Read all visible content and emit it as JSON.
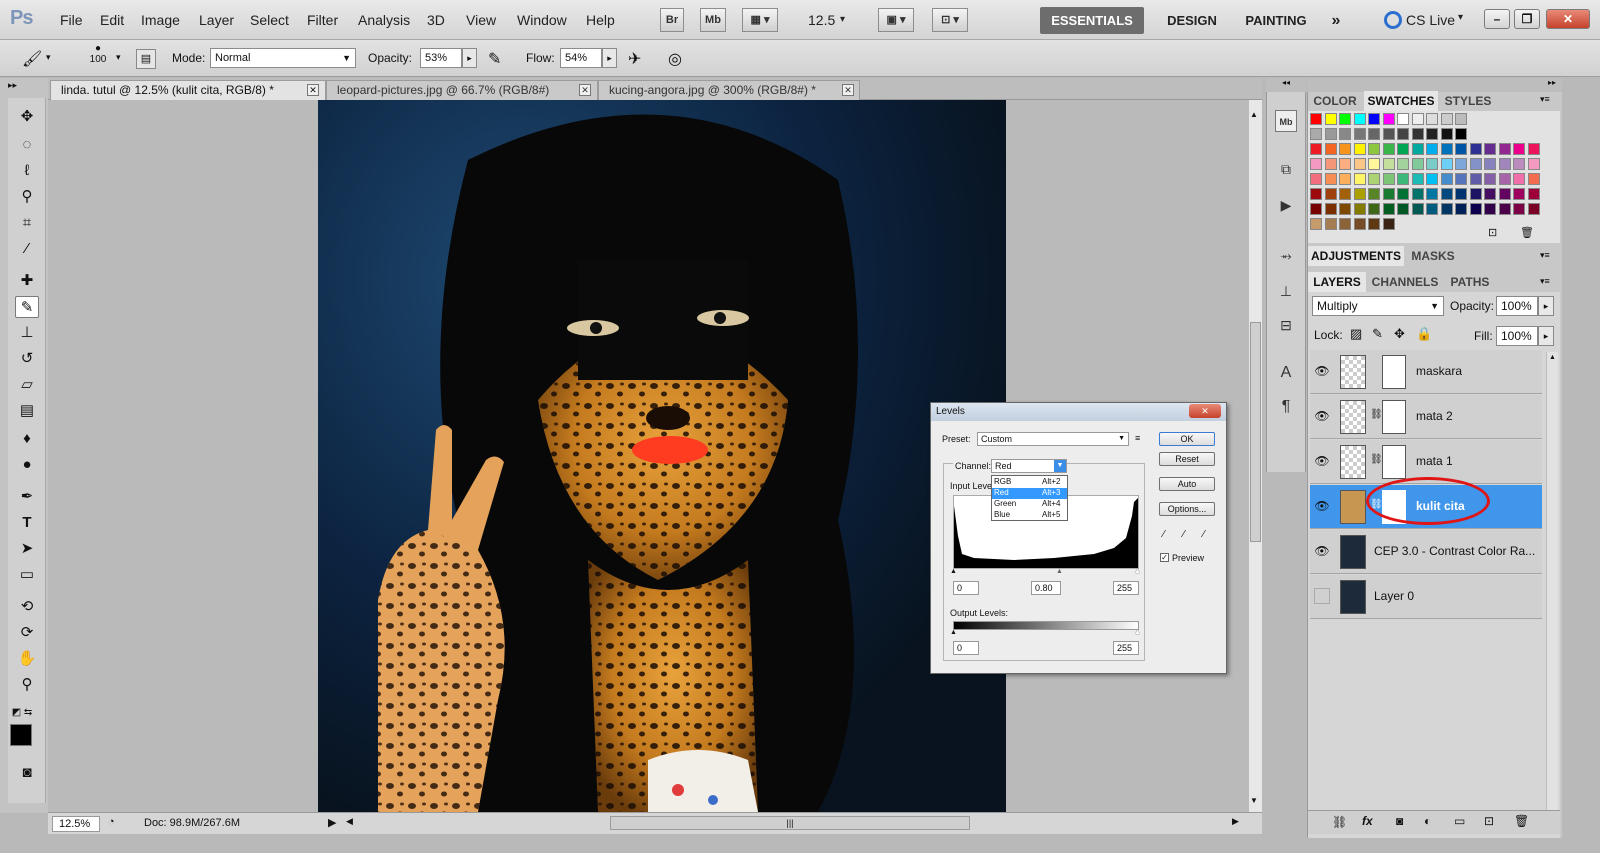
{
  "menubar": {
    "logo": "Ps",
    "items": [
      "File",
      "Edit",
      "Image",
      "Layer",
      "Select",
      "Filter",
      "Analysis",
      "3D",
      "View",
      "Window",
      "Help"
    ],
    "bridge": "Br",
    "minibridge": "Mb",
    "zoom": "12.5",
    "workspaces": [
      "ESSENTIALS",
      "DESIGN",
      "PAINTING"
    ],
    "more": "»",
    "cslive": "CS Live"
  },
  "options": {
    "brush_size": "100",
    "mode_label": "Mode:",
    "mode_value": "Normal",
    "opacity_label": "Opacity:",
    "opacity_value": "53%",
    "flow_label": "Flow:",
    "flow_value": "54%"
  },
  "tabs": [
    {
      "label": "linda. tutul @ 12.5% (kulit cita, RGB/8) *"
    },
    {
      "label": "leopard-pictures.jpg @ 66.7% (RGB/8#)"
    },
    {
      "label": "kucing-angora.jpg @ 300% (RGB/8#) *"
    }
  ],
  "status": {
    "zoom": "12.5%",
    "doc": "Doc: 98.9M/267.6M"
  },
  "panels": {
    "top_tabs": [
      "COLOR",
      "SWATCHES",
      "STYLES"
    ],
    "adj_tabs": [
      "ADJUSTMENTS",
      "MASKS"
    ],
    "layer_tabs": [
      "LAYERS",
      "CHANNELS",
      "PATHS"
    ],
    "blend_mode": "Multiply",
    "opacity_label": "Opacity:",
    "opacity_value": "100%",
    "lock_label": "Lock:",
    "fill_label": "Fill:",
    "fill_value": "100%",
    "layers": [
      {
        "name": "maskara"
      },
      {
        "name": "mata 2"
      },
      {
        "name": "mata 1"
      },
      {
        "name": "kulit cita"
      },
      {
        "name": "CEP 3.0 - Contrast Color Ra..."
      },
      {
        "name": "Layer 0"
      }
    ]
  },
  "swatch_colors": [
    "#ff0000",
    "#ffff00",
    "#00ff00",
    "#00ffff",
    "#0000ff",
    "#ff00ff",
    "#ffffff",
    "#eeeeee",
    "#dddddd",
    "#cccccc",
    "#bbbbbb",
    "#aaaaaa",
    "#999999",
    "#888888",
    "#777777",
    "#666666",
    "#555555",
    "#444444",
    "#333333",
    "#222222",
    "#111111",
    "#000000",
    "#ed1c24",
    "#f26522",
    "#f7941d",
    "#fff200",
    "#8dc63f",
    "#39b54a",
    "#00a651",
    "#00a99d",
    "#00aeef",
    "#0072bc",
    "#0054a6",
    "#2e3192",
    "#662d91",
    "#92278f",
    "#ec008c",
    "#ed145b",
    "#f49ac1",
    "#f69679",
    "#f9ad81",
    "#fdc689",
    "#fff799",
    "#c4df9b",
    "#a3d39c",
    "#82ca9c",
    "#7accc8",
    "#6dcff6",
    "#7da7d9",
    "#8393ca",
    "#8781bd",
    "#a186be",
    "#bd8cbf",
    "#f49ac1",
    "#f26d7d",
    "#f68e56",
    "#fbaf5d",
    "#fff467",
    "#acd373",
    "#7cc576",
    "#3cb878",
    "#1cbbb4",
    "#00bff3",
    "#448ccb",
    "#5574b9",
    "#605ca8",
    "#8560a8",
    "#a864a8",
    "#f06eaa",
    "#f26c4f",
    "#9e0b0f",
    "#a0410d",
    "#a36209",
    "#aba000",
    "#598527",
    "#197b30",
    "#007236",
    "#00746b",
    "#0076a3",
    "#004a80",
    "#003471",
    "#1b1464",
    "#440e62",
    "#630460",
    "#9e005d",
    "#9e0039",
    "#790000",
    "#7b2e00",
    "#7d4900",
    "#827b00",
    "#406618",
    "#005e20",
    "#005826",
    "#005952",
    "#005b7f",
    "#003663",
    "#002157",
    "#0d004c",
    "#32004b",
    "#4b0049",
    "#7b0046",
    "#7a0026",
    "#c69c6d",
    "#a67c52",
    "#8c6239",
    "#754c24",
    "#603913",
    "#3c2415"
  ],
  "levels": {
    "title": "Levels",
    "preset_label": "Preset:",
    "preset_value": "Custom",
    "channel_label": "Channel:",
    "channel_value": "Red",
    "input_label": "Input Levels:",
    "input_black": "0",
    "input_gamma": "0.80",
    "input_white": "255",
    "output_label": "Output Levels:",
    "output_black": "0",
    "output_white": "255",
    "buttons": [
      "OK",
      "Reset",
      "Auto",
      "Options..."
    ],
    "preview_label": "Preview",
    "dropdown": [
      {
        "name": "RGB",
        "shortcut": "Alt+2"
      },
      {
        "name": "Red",
        "shortcut": "Alt+3"
      },
      {
        "name": "Green",
        "shortcut": "Alt+4"
      },
      {
        "name": "Blue",
        "shortcut": "Alt+5"
      }
    ]
  }
}
